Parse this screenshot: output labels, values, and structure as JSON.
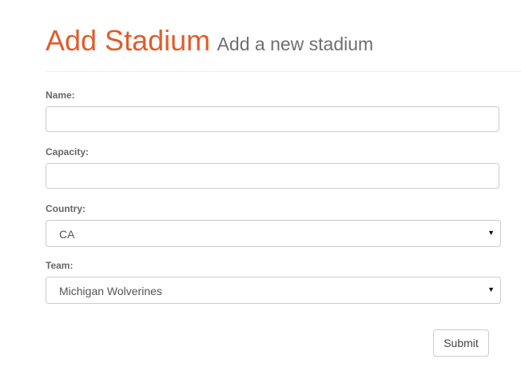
{
  "header": {
    "title": "Add Stadium",
    "subtitle": "Add a new stadium"
  },
  "form": {
    "name": {
      "label": "Name:",
      "value": ""
    },
    "capacity": {
      "label": "Capacity:",
      "value": ""
    },
    "country": {
      "label": "Country:",
      "selected": "CA",
      "icon": "caret-down-icon"
    },
    "team": {
      "label": "Team:",
      "selected": "Michigan Wolverines",
      "icon": "caret-down-icon"
    },
    "submit_label": "Submit"
  },
  "colors": {
    "title": "#e05d2c",
    "subtitle": "#6f6f6f",
    "border": "#cccccc"
  }
}
